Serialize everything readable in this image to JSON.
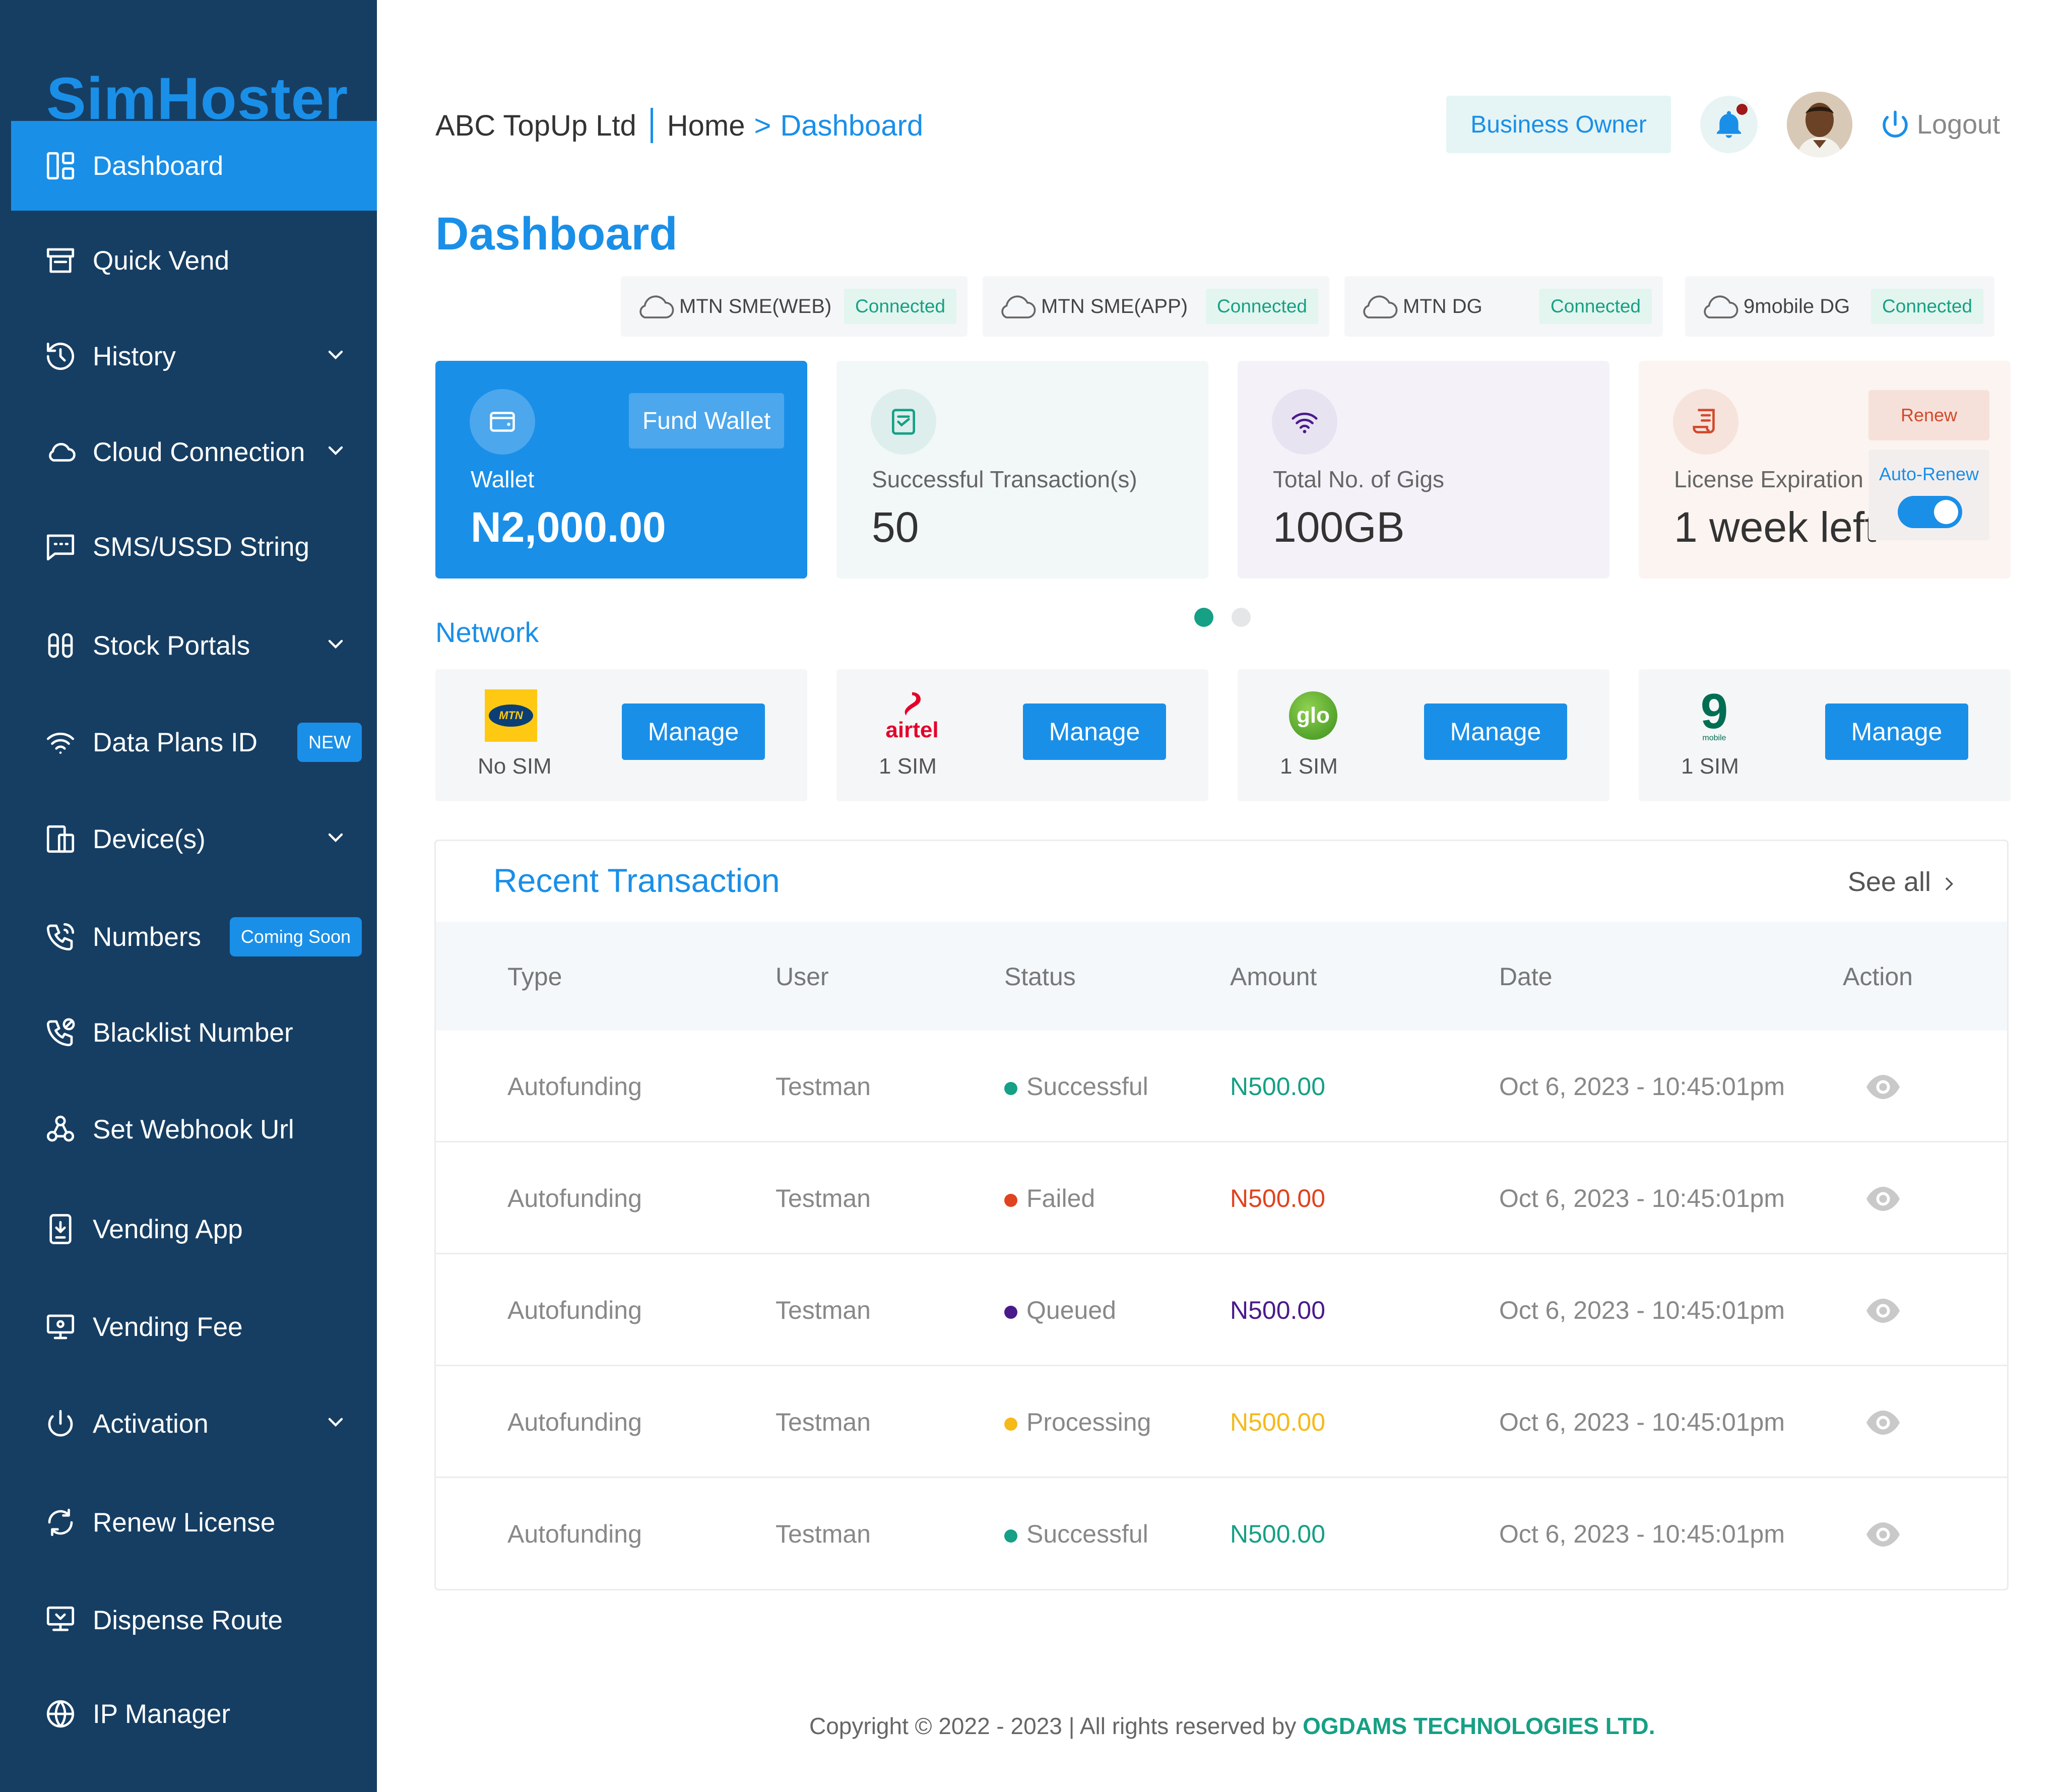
{
  "app": {
    "logo": "SimHoster"
  },
  "sidebar": {
    "items": [
      {
        "label": "Dashboard",
        "icon": "dashboard-icon",
        "active": true,
        "has_chevron": false
      },
      {
        "label": "Quick Vend",
        "icon": "store-icon",
        "has_chevron": false
      },
      {
        "label": "History",
        "icon": "history-icon",
        "has_chevron": true
      },
      {
        "label": "Cloud Connection",
        "icon": "cloud-icon",
        "has_chevron": true
      },
      {
        "label": "SMS/USSD String",
        "icon": "message-icon",
        "has_chevron": false
      },
      {
        "label": "Stock Portals",
        "icon": "sliders-icon",
        "has_chevron": true
      },
      {
        "label": "Data Plans ID",
        "icon": "wifi-icon",
        "badge": "NEW",
        "has_chevron": false
      },
      {
        "label": "Device(s)",
        "icon": "devices-icon",
        "has_chevron": true
      },
      {
        "label": "Numbers",
        "icon": "phone-icon",
        "badge": "Coming Soon",
        "has_chevron": false
      },
      {
        "label": "Blacklist Number",
        "icon": "phone-block-icon",
        "has_chevron": false
      },
      {
        "label": "Set Webhook Url",
        "icon": "webhook-icon",
        "has_chevron": false
      },
      {
        "label": "Vending App",
        "icon": "mobile-download-icon",
        "has_chevron": false
      },
      {
        "label": "Vending Fee",
        "icon": "monitor-icon",
        "has_chevron": false
      },
      {
        "label": "Activation",
        "icon": "power-icon",
        "has_chevron": true
      },
      {
        "label": "Renew License",
        "icon": "refresh-icon",
        "has_chevron": false
      },
      {
        "label": "Dispense Route",
        "icon": "route-icon",
        "has_chevron": false
      },
      {
        "label": "IP Manager",
        "icon": "globe-icon",
        "has_chevron": false
      }
    ]
  },
  "header": {
    "company": "ABC TopUp Ltd",
    "breadcrumb_home": "Home",
    "breadcrumb_arrow": ">",
    "breadcrumb_current": "Dashboard",
    "role": "Business Owner",
    "logout": "Logout"
  },
  "page_title": "Dashboard",
  "connections": [
    {
      "name": "MTN SME(WEB)",
      "status": "Connected"
    },
    {
      "name": "MTN SME(APP)",
      "status": "Connected"
    },
    {
      "name": "MTN DG",
      "status": "Connected"
    },
    {
      "name": "9mobile DG",
      "status": "Connected"
    }
  ],
  "cards": {
    "wallet": {
      "label": "Wallet",
      "value": "N2,000.00",
      "action": "Fund Wallet"
    },
    "transactions": {
      "label": "Successful Transaction(s)",
      "value": "50"
    },
    "gigs": {
      "label": "Total No. of Gigs",
      "value": "100GB"
    },
    "license": {
      "label": "License Expiration",
      "value": "1 week left",
      "action": "Renew",
      "auto_renew_label": "Auto-Renew",
      "auto_renew_on": true
    }
  },
  "carousel": {
    "pages": 2,
    "active": 1
  },
  "network": {
    "title": "Network",
    "items": [
      {
        "provider": "MTN",
        "logo_text": "MTN",
        "sims": "No SIM",
        "action": "Manage"
      },
      {
        "provider": "airtel",
        "logo_text": "airtel",
        "sims": "1 SIM",
        "action": "Manage"
      },
      {
        "provider": "glo",
        "logo_text": "glo",
        "sims": "1 SIM",
        "action": "Manage"
      },
      {
        "provider": "9mobile",
        "logo_text": "9",
        "logo_subtext": "mobile",
        "sims": "1 SIM",
        "action": "Manage"
      }
    ]
  },
  "recent": {
    "title": "Recent Transaction",
    "see_all": "See all",
    "columns": [
      "Type",
      "User",
      "Status",
      "Amount",
      "Date",
      "Action"
    ],
    "rows": [
      {
        "type": "Autofunding",
        "user": "Testman",
        "status": "Successful",
        "amount": "N500.00",
        "date": "Oct 6, 2023 - 10:45:01pm",
        "color": "#16a085"
      },
      {
        "type": "Autofunding",
        "user": "Testman",
        "status": "Failed",
        "amount": "N500.00",
        "date": "Oct 6, 2023 - 10:45:01pm",
        "color": "#e0431f"
      },
      {
        "type": "Autofunding",
        "user": "Testman",
        "status": "Queued",
        "amount": "N500.00",
        "date": "Oct 6, 2023 - 10:45:01pm",
        "color": "#4b1a8a"
      },
      {
        "type": "Autofunding",
        "user": "Testman",
        "status": "Processing",
        "amount": "N500.00",
        "date": "Oct 6, 2023 - 10:45:01pm",
        "color": "#f5b91a"
      },
      {
        "type": "Autofunding",
        "user": "Testman",
        "status": "Successful",
        "amount": "N500.00",
        "date": "Oct 6, 2023 - 10:45:01pm",
        "color": "#16a085"
      }
    ]
  },
  "footer": {
    "text": "Copyright © 2022 - 2023 | All rights reserved by ",
    "company": "OGDAMS TECHNOLOGIES LTD."
  },
  "colors": {
    "sidebar_bg": "#163e63",
    "accent": "#1a8fe8",
    "success": "#16a085",
    "failed": "#e0431f",
    "queued": "#4b1a8a",
    "processing": "#f5b91a"
  }
}
